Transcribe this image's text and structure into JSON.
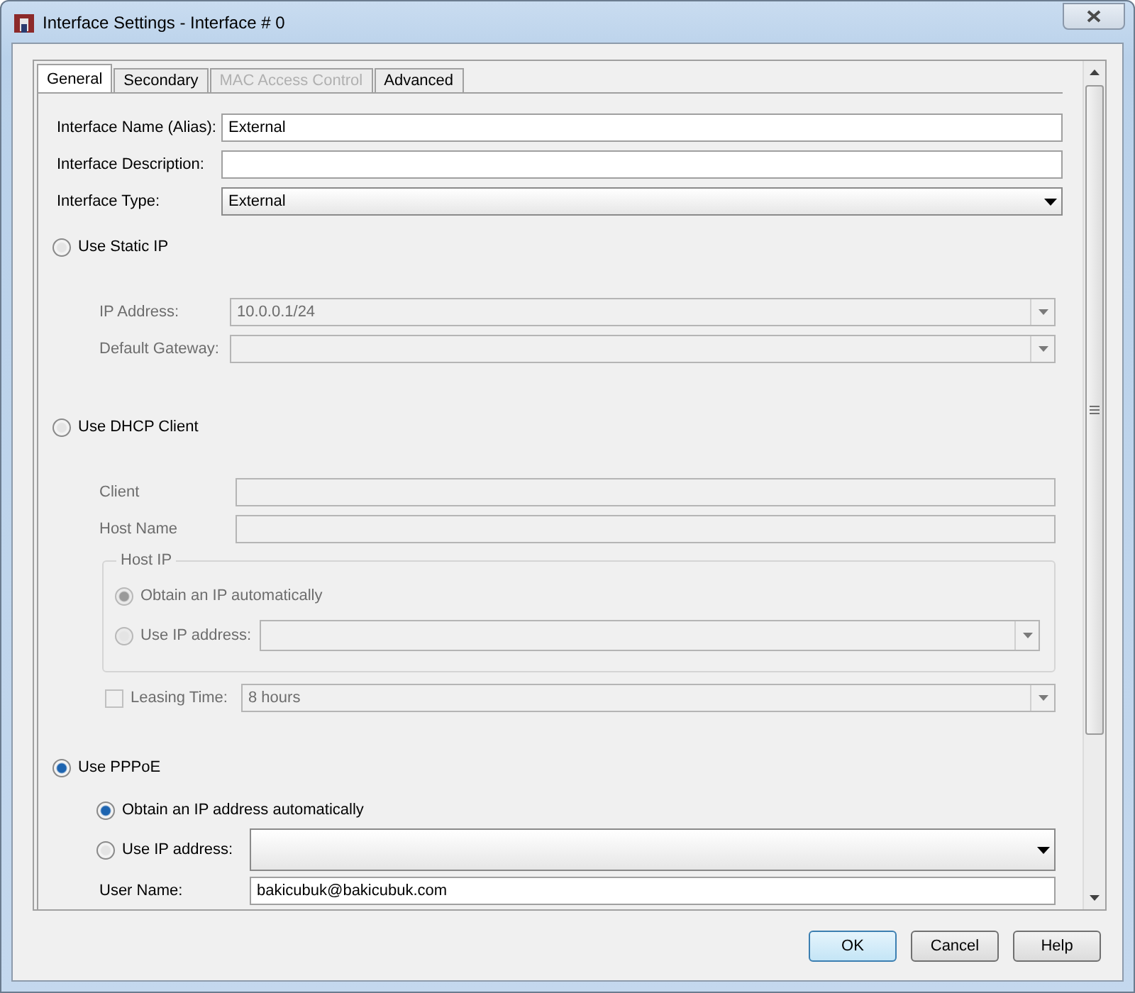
{
  "window": {
    "title": "Interface Settings - Interface # 0"
  },
  "tabs": [
    {
      "label": "General",
      "selected": true,
      "disabled": false
    },
    {
      "label": "Secondary",
      "selected": false,
      "disabled": false
    },
    {
      "label": "MAC Access Control",
      "selected": false,
      "disabled": true
    },
    {
      "label": "Advanced",
      "selected": false,
      "disabled": false
    }
  ],
  "general_fields": [
    {
      "label": "Interface Name (Alias):",
      "value": "External",
      "kind": "text"
    },
    {
      "label": "Interface Description:",
      "kind": "text"
    },
    {
      "label": "Interface Type:",
      "value": "External",
      "kind": "dropdown"
    }
  ],
  "modes": [
    {
      "label": "Use Static IP",
      "selected": false,
      "fields": [
        {
          "label": "IP Address:",
          "value": "10.0.0.1/24",
          "kind": "dropdown",
          "disabled": true
        },
        {
          "label": "Default Gateway:",
          "kind": "dropdown",
          "disabled": true
        }
      ]
    },
    {
      "label": "Use DHCP Client",
      "selected": false,
      "fields": [
        {
          "label": "Client",
          "kind": "text",
          "disabled": true
        },
        {
          "label": "Host Name",
          "kind": "text",
          "disabled": true
        }
      ],
      "host_ip": {
        "title": "Host IP",
        "options": [
          {
            "label": "Obtain an IP automatically",
            "selected": true,
            "disabled": true,
            "kind": "radio"
          },
          {
            "label": "Use IP address:",
            "selected": false,
            "disabled": true,
            "kind": "radio-dropdown"
          }
        ]
      },
      "leasing": {
        "label": "Leasing Time:",
        "checked": false,
        "disabled": true,
        "value": "8 hours"
      }
    },
    {
      "label": "Use PPPoE",
      "selected": true,
      "options": [
        {
          "label": "Obtain an IP address automatically",
          "selected": true,
          "disabled": false,
          "kind": "radio"
        },
        {
          "label": "Use IP address:",
          "selected": false,
          "disabled": false,
          "kind": "radio-dropdown"
        }
      ],
      "fields": [
        {
          "label": "User Name:",
          "value": "bakicubuk@bakicubuk.com",
          "kind": "text",
          "disabled": false
        }
      ]
    }
  ],
  "buttons": [
    {
      "label": "OK",
      "default": true
    },
    {
      "label": "Cancel",
      "default": false
    },
    {
      "label": "Help",
      "default": false
    }
  ]
}
